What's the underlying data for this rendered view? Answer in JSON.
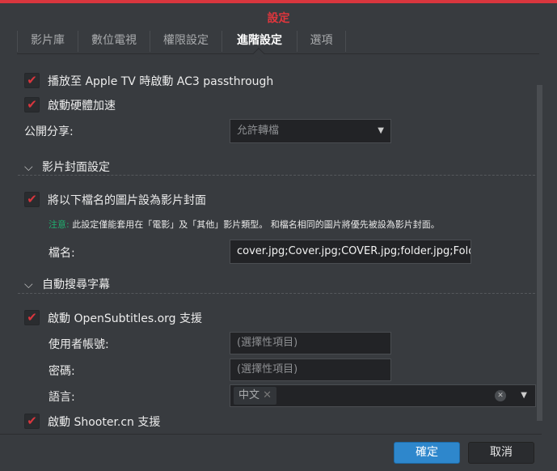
{
  "dialog": {
    "title": "設定"
  },
  "tabs": [
    {
      "label": "影片庫"
    },
    {
      "label": "數位電視"
    },
    {
      "label": "權限設定"
    },
    {
      "label": "進階設定"
    },
    {
      "label": "選項"
    }
  ],
  "general": {
    "ac3_label": "播放至 Apple TV 時啟動 AC3 passthrough",
    "hw_accel_label": "啟動硬體加速",
    "public_share_label": "公開分享:",
    "public_share_value": "允許轉檔"
  },
  "cover": {
    "section_title": "影片封面設定",
    "enable_label": "將以下檔名的圖片設為影片封面",
    "note_prefix": "注意:",
    "note_text": "此設定僅能套用在「電影」及「其他」影片類型。 和檔名相同的圖片將優先被設為影片封面。",
    "filename_label": "檔名:",
    "filename_value": "cover.jpg;Cover.jpg;COVER.jpg;folder.jpg;Folder.jpg"
  },
  "subtitles": {
    "section_title": "自動搜尋字幕",
    "opensubtitles_label": "啟動 OpenSubtitles.org 支援",
    "username_label": "使用者帳號:",
    "username_placeholder": "(選擇性項目)",
    "password_label": "密碼:",
    "password_placeholder": "(選擇性項目)",
    "language_label": "語言:",
    "language_tag": "中文",
    "shooter_label": "啟動 Shooter.cn 支援"
  },
  "footer": {
    "ok": "確定",
    "cancel": "取消"
  },
  "colors": {
    "accent": "#d9363e",
    "primary_button": "#2e87cc",
    "note": "#1fae6e"
  }
}
